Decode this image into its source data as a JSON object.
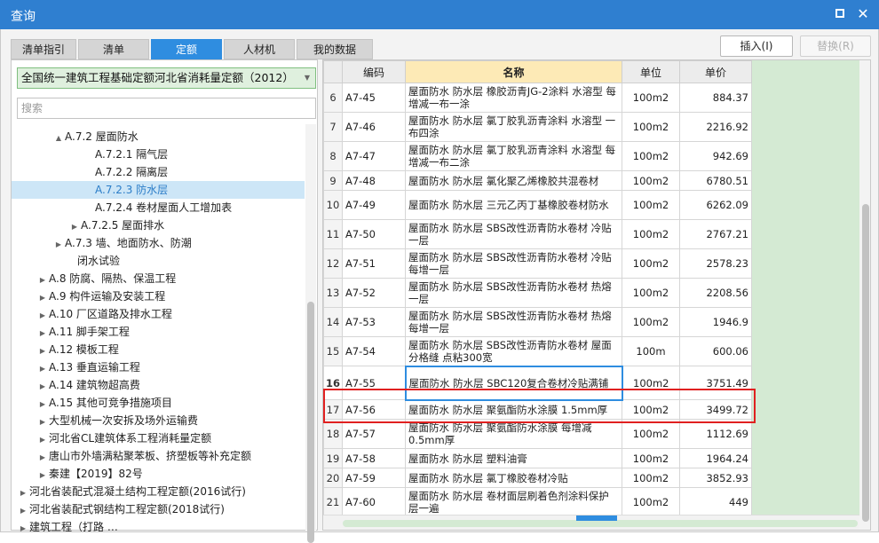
{
  "window": {
    "title": "查询"
  },
  "tabs": [
    "清单指引",
    "清单",
    "定额",
    "人材机",
    "我的数据"
  ],
  "active_tab": 2,
  "buttons": {
    "insert": "插入(I)",
    "replace": "替换(R)"
  },
  "left": {
    "combo_value": "全国统一建筑工程基础定额河北省消耗量定额（2012）",
    "search_placeholder": "搜索",
    "tree": [
      {
        "label": "A.7.2 屋面防水",
        "exp": "▲",
        "indent": 46
      },
      {
        "label": "A.7.2.1 隔气层",
        "exp": "",
        "indent": 80
      },
      {
        "label": "A.7.2.2 隔离层",
        "exp": "",
        "indent": 80
      },
      {
        "label": "A.7.2.3 防水层",
        "exp": "",
        "indent": 80,
        "selected": true
      },
      {
        "label": "A.7.2.4 卷材屋面人工增加表",
        "exp": "",
        "indent": 80
      },
      {
        "label": "A.7.2.5 屋面排水",
        "exp": "▶",
        "indent": 64
      },
      {
        "label": "A.7.3 墙、地面防水、防潮",
        "exp": "▶",
        "indent": 46
      },
      {
        "label": "闭水试验",
        "exp": "",
        "indent": 60
      },
      {
        "label": "A.8 防腐、隔热、保温工程",
        "exp": "▶",
        "indent": 28
      },
      {
        "label": "A.9 构件运输及安装工程",
        "exp": "▶",
        "indent": 28
      },
      {
        "label": "A.10 厂区道路及排水工程",
        "exp": "▶",
        "indent": 28
      },
      {
        "label": "A.11 脚手架工程",
        "exp": "▶",
        "indent": 28
      },
      {
        "label": "A.12 模板工程",
        "exp": "▶",
        "indent": 28
      },
      {
        "label": "A.13 垂直运输工程",
        "exp": "▶",
        "indent": 28
      },
      {
        "label": "A.14 建筑物超高费",
        "exp": "▶",
        "indent": 28
      },
      {
        "label": "A.15 其他可竞争措施项目",
        "exp": "▶",
        "indent": 28
      },
      {
        "label": "大型机械一次安拆及场外运输费",
        "exp": "▶",
        "indent": 28
      },
      {
        "label": "河北省CL建筑体系工程消耗量定额",
        "exp": "▶",
        "indent": 28
      },
      {
        "label": "唐山市外墙满粘聚苯板、挤塑板等补充定额",
        "exp": "▶",
        "indent": 28
      },
      {
        "label": "秦建【2019】82号",
        "exp": "▶",
        "indent": 28
      },
      {
        "label": "河北省装配式混凝土结构工程定额(2016试行)",
        "exp": "▶",
        "indent": 6
      },
      {
        "label": "河北省装配式钢结构工程定额(2018试行)",
        "exp": "▶",
        "indent": 6
      },
      {
        "label": "建筑工程（打路 …",
        "exp": "▶",
        "indent": 6
      }
    ]
  },
  "grid": {
    "headers": {
      "code": "编码",
      "name": "名称",
      "unit": "单位",
      "price": "单价"
    },
    "rows": [
      {
        "no": "6",
        "code": "A7-45",
        "name": "屋面防水 防水层 橡胶沥青JG-2涂料 水溶型 每增减一布一涂",
        "unit": "100m2",
        "price": "884.37"
      },
      {
        "no": "7",
        "code": "A7-46",
        "name": "屋面防水 防水层 氯丁胶乳沥青涂料 水溶型 一布四涂",
        "unit": "100m2",
        "price": "2216.92"
      },
      {
        "no": "8",
        "code": "A7-47",
        "name": "屋面防水 防水层 氯丁胶乳沥青涂料 水溶型 每增减一布二涂",
        "unit": "100m2",
        "price": "942.69"
      },
      {
        "no": "9",
        "code": "A7-48",
        "name": "屋面防水 防水层 氯化聚乙烯橡胶共混卷材",
        "unit": "100m2",
        "price": "6780.51"
      },
      {
        "no": "10",
        "code": "A7-49",
        "name": "屋面防水 防水层 三元乙丙丁基橡胶卷材防水",
        "unit": "100m2",
        "price": "6262.09"
      },
      {
        "no": "11",
        "code": "A7-50",
        "name": "屋面防水 防水层 SBS改性沥青防水卷材 冷贴 一层",
        "unit": "100m2",
        "price": "2767.21"
      },
      {
        "no": "12",
        "code": "A7-51",
        "name": "屋面防水 防水层 SBS改性沥青防水卷材 冷贴 每增一层",
        "unit": "100m2",
        "price": "2578.23"
      },
      {
        "no": "13",
        "code": "A7-52",
        "name": "屋面防水 防水层 SBS改性沥青防水卷材 热熔 一层",
        "unit": "100m2",
        "price": "2208.56"
      },
      {
        "no": "14",
        "code": "A7-53",
        "name": "屋面防水 防水层 SBS改性沥青防水卷材 热熔 每增一层",
        "unit": "100m2",
        "price": "1946.9"
      },
      {
        "no": "15",
        "code": "A7-54",
        "name": "屋面防水 防水层 SBS改性沥青防水卷材 屋面分格缝 点粘300宽",
        "unit": "100m",
        "price": "600.06"
      },
      {
        "no": "16",
        "code": "A7-55",
        "name": "屋面防水 防水层 SBC120复合卷材冷贴满铺",
        "unit": "100m2",
        "price": "3751.49",
        "current": true
      },
      {
        "no": "17",
        "code": "A7-56",
        "name": "屋面防水 防水层 聚氨酯防水涂膜 1.5mm厚",
        "unit": "100m2",
        "price": "3499.72"
      },
      {
        "no": "18",
        "code": "A7-57",
        "name": "屋面防水 防水层 聚氨酯防水涂膜 每增减0.5mm厚",
        "unit": "100m2",
        "price": "1112.69"
      },
      {
        "no": "19",
        "code": "A7-58",
        "name": "屋面防水 防水层 塑料油膏",
        "unit": "100m2",
        "price": "1964.24"
      },
      {
        "no": "20",
        "code": "A7-59",
        "name": "屋面防水 防水层 氯丁橡胶卷材冷贴",
        "unit": "100m2",
        "price": "3852.93"
      },
      {
        "no": "21",
        "code": "A7-60",
        "name": "屋面防水 防水层 卷材面层刷着色剂涂料保护层一遍",
        "unit": "100m2",
        "price": "449"
      }
    ]
  }
}
